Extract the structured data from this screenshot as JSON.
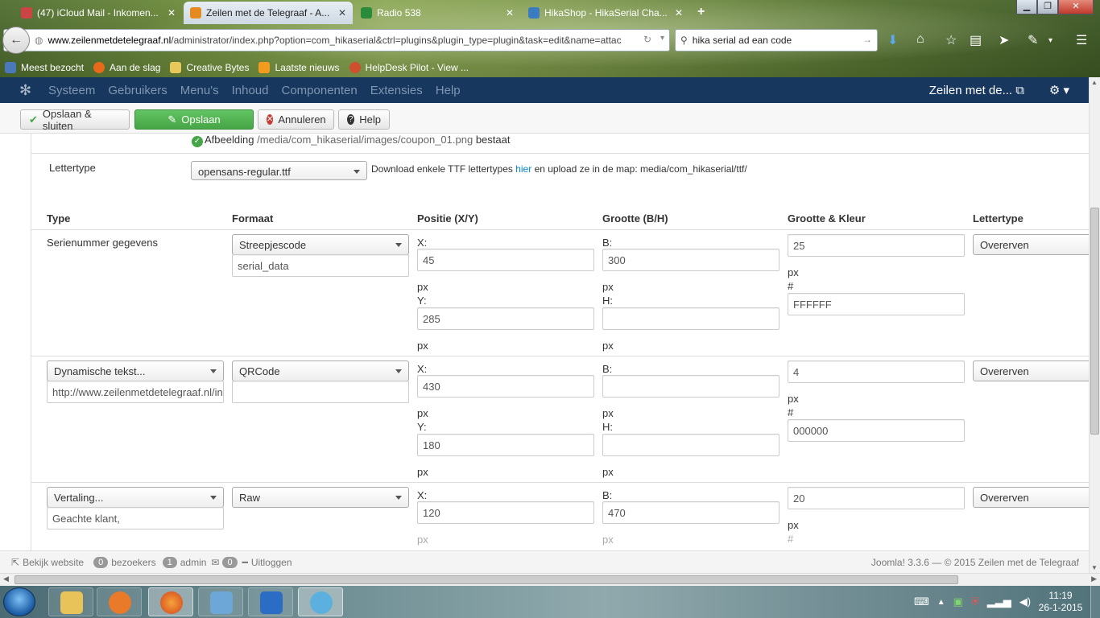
{
  "browser": {
    "tabs": [
      {
        "label": "(47) iCloud Mail - Inkomen...",
        "active": false
      },
      {
        "label": "Zeilen met de Telegraaf - A...",
        "active": true
      },
      {
        "label": "Radio 538",
        "active": false
      },
      {
        "label": "HikaShop - HikaSerial Cha...",
        "active": false
      }
    ],
    "url_domain": "www.zeilenmetdetelegraaf.nl",
    "url_path": "/administrator/index.php?option=com_hikaserial&ctrl=plugins&plugin_type=plugin&task=edit&name=attac",
    "search_value": "hika serial ad ean code",
    "bookmarks": [
      "Meest bezocht",
      "Aan de slag",
      "Creative Bytes",
      "Laatste nieuws",
      "HelpDesk Pilot - View ..."
    ]
  },
  "nav": {
    "items": [
      "Systeem",
      "Gebruikers",
      "Menu's",
      "Inhoud",
      "Componenten",
      "Extensies",
      "Help"
    ],
    "site_name": "Zeilen met de..."
  },
  "toolbar": {
    "save_close": "Opslaan & sluiten",
    "save": "Opslaan",
    "cancel": "Annuleren",
    "help": "Help"
  },
  "form": {
    "image_line_prefix": "Afbeelding",
    "image_path": "/media/com_hikaserial/images/coupon_01.png",
    "image_line_suffix": "bestaat",
    "font_label": "Lettertype",
    "font_value": "opensans-regular.ttf",
    "font_help_before": "Download enkele TTF lettertypes",
    "font_help_link": "hier",
    "font_help_after": "en upload ze in de map: media/com_hikaserial/ttf/"
  },
  "table": {
    "headers": [
      "Type",
      "Formaat",
      "Positie (X/Y)",
      "Grootte (B/H)",
      "Grootte & Kleur",
      "Lettertype"
    ],
    "labels": {
      "x": "X:",
      "y": "Y:",
      "b": "B:",
      "h": "H:",
      "px": "px",
      "hash": "#"
    },
    "rows": [
      {
        "type": "Serienummer gegevens",
        "format": "Streepjescode",
        "format_extra": "serial_data",
        "x": "45",
        "y": "285",
        "b": "300",
        "h": "",
        "size": "25",
        "color": "FFFFFF",
        "font": "Overerven"
      },
      {
        "type": "Dynamische tekst...",
        "type_extra": "http://www.zeilenmetdetelegraaf.nl/in",
        "format": "QRCode",
        "format_extra": "",
        "x": "430",
        "y": "180",
        "b": "",
        "h": "",
        "size": "4",
        "color": "000000",
        "font": "Overerven"
      },
      {
        "type": "Vertaling...",
        "type_extra": "Geachte klant,",
        "format": "Raw",
        "x": "120",
        "b": "470",
        "size": "20",
        "font": "Overerven"
      }
    ]
  },
  "status": {
    "view_site": "Bekijk website",
    "visitors_count": "0",
    "visitors_label": "bezoekers",
    "admin_count": "1",
    "admin_label": "admin",
    "messages_count": "0",
    "logout": "Uitloggen",
    "copyright": "Joomla! 3.3.6  —  © 2015 Zeilen met de Telegraaf"
  },
  "taskbar": {
    "time": "11:19",
    "date": "26-1-2015"
  },
  "colors": {
    "navbar": "#17375e",
    "save_green": "#46a546",
    "link_blue": "#0088cc"
  }
}
